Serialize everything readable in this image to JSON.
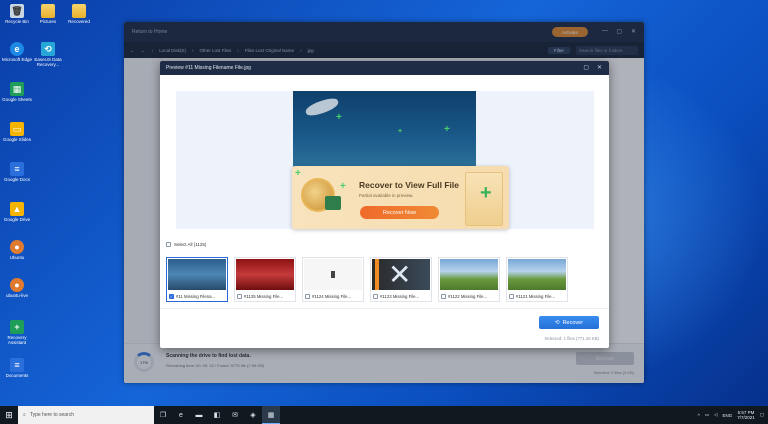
{
  "desktop": {
    "icons": [
      {
        "label": "Recycle Bin",
        "glyph": "🗑",
        "kind": "bin"
      },
      {
        "label": "Pictures",
        "glyph": "",
        "kind": "folder"
      },
      {
        "label": "Recovered",
        "glyph": "",
        "kind": "folder"
      },
      {
        "label": "Microsoft Edge",
        "glyph": "e",
        "kind": "edge"
      },
      {
        "label": "EaseUS Data Recovery...",
        "glyph": "⟲",
        "kind": "app"
      },
      {
        "label": "Google Sheets",
        "glyph": "▦",
        "kind": "gsheet"
      },
      {
        "label": "Google Slides",
        "glyph": "▭",
        "kind": "gslide"
      },
      {
        "label": "Google Docs",
        "glyph": "≡",
        "kind": "gdoc"
      },
      {
        "label": "Google Drive",
        "glyph": "▲",
        "kind": "gslide"
      },
      {
        "label": "Ubuntu",
        "glyph": "●",
        "kind": "person"
      },
      {
        "label": "ubuntu-live",
        "glyph": "●",
        "kind": "person"
      },
      {
        "label": "Recovery Assistant",
        "glyph": "+",
        "kind": "gsheet"
      },
      {
        "label": "Documents",
        "glyph": "≡",
        "kind": "gdoc"
      }
    ]
  },
  "app_window": {
    "return_label": "Return to Home",
    "activate_label": "Activate",
    "breadcrumb": [
      "Local Disk(E)",
      "Other Lost Files",
      "Files Lost Original Name",
      "jpg"
    ],
    "filter_label": "Filter",
    "search_placeholder": "Search files or folders",
    "progress_label": "17%",
    "scan_title": "Scanning the drive to find lost data.",
    "scan_sub": "Remaining time: 00: 00: 32 / Found: 5775 file (7.99 GB)",
    "recover_label": "Recover",
    "selected_info": "Selected: 0 files (0 KB)"
  },
  "modal": {
    "title": "Preview #11 Missing Filename File.jpg",
    "banner_title": "Recover to View Full File",
    "banner_sub": "Partial available in preview.",
    "recover_now_label": "Recover Now",
    "select_all_label": "Select All (1125)",
    "thumbnails": [
      {
        "label": "#11 Missing Filena...",
        "checked": true,
        "style": "p-fish"
      },
      {
        "label": "#1125 Missing File...",
        "checked": false,
        "style": "p-red"
      },
      {
        "label": "#1124 Missing File...",
        "checked": false,
        "style": "p-white"
      },
      {
        "label": "#1123 Missing File...",
        "checked": false,
        "style": "p-x"
      },
      {
        "label": "#1122 Missing File...",
        "checked": false,
        "style": "p-castle"
      },
      {
        "label": "#1121 Missing File...",
        "checked": false,
        "style": "p-castle"
      }
    ],
    "recover_label": "Recover",
    "selected_info": "Selected: 1 files (771.26 KB)"
  },
  "taskbar": {
    "search_placeholder": "Type here to search",
    "lang": "ENG",
    "time": "5:57 PM",
    "date": "7/7/2021"
  }
}
